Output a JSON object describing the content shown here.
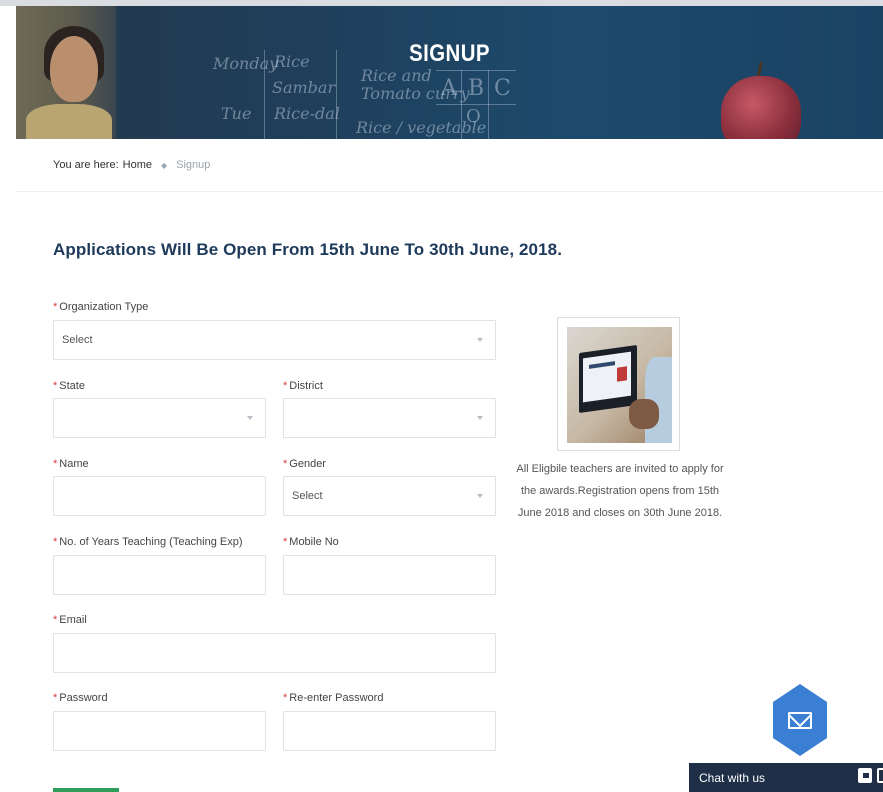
{
  "hero": {
    "title": "SIGNUP",
    "chalk_words": [
      "Monday",
      "Rice",
      "Sambar",
      "Rice and",
      "Tomato curry",
      "Tue",
      "Rice-dal",
      "Rice / vegetable",
      "A",
      "B",
      "C",
      "O"
    ]
  },
  "breadcrumb": {
    "prefix": "You are here:",
    "home": "Home",
    "current": "Signup"
  },
  "heading": "Applications Will Be Open From 15th June To 30th June, 2018.",
  "form": {
    "organization_type": {
      "label": "Organization Type",
      "value": "Select"
    },
    "state": {
      "label": "State",
      "value": ""
    },
    "district": {
      "label": "District",
      "value": ""
    },
    "name": {
      "label": "Name",
      "value": ""
    },
    "gender": {
      "label": "Gender",
      "value": "Select"
    },
    "years_teaching": {
      "label": "No. of Years Teaching (Teaching Exp)",
      "value": ""
    },
    "mobile": {
      "label": "Mobile No",
      "value": ""
    },
    "email": {
      "label": "Email",
      "value": ""
    },
    "password": {
      "label": "Password",
      "value": ""
    },
    "reenter_password": {
      "label": "Re-enter Password",
      "value": ""
    },
    "required_mark": "*"
  },
  "sidebar": {
    "info_text": "All Eligbile teachers are invited to apply for the awards.Registration opens from 15th June 2018 and closes on 30th June 2018."
  },
  "chat": {
    "label": "Chat with us"
  },
  "colors": {
    "heading": "#1e3a5b",
    "required": "#d63a3a",
    "hexagon": "#3b7fd4",
    "chat_bar": "#1f2f47",
    "submit": "#2f9e5a"
  },
  "icons": [
    "mail-icon",
    "chat-bubble-icon",
    "chat-window-icon",
    "dropdown-caret-icon"
  ]
}
